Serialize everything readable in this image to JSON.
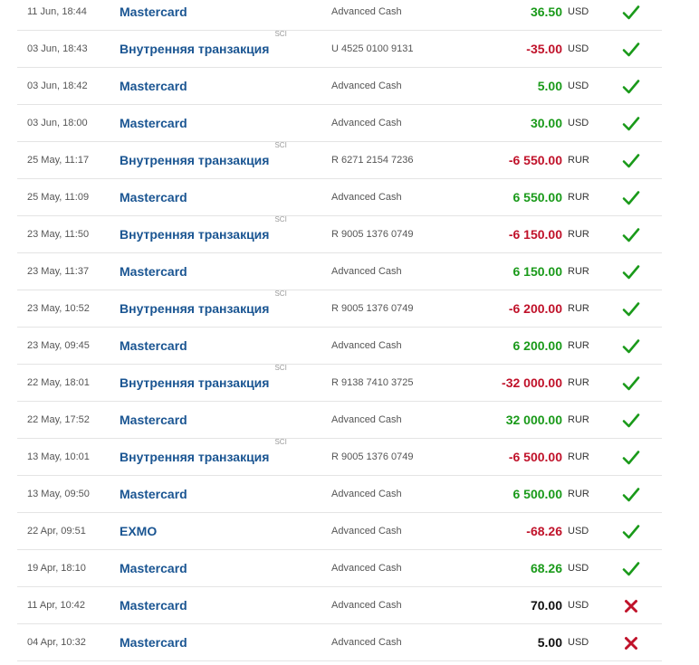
{
  "colors": {
    "link": "#1a5592",
    "positive": "#1a9a1a",
    "negative": "#c0122a",
    "check": "#1a9a1a",
    "cross": "#c0122a"
  },
  "transactions": [
    {
      "date": "11 Jun, 18:44",
      "name": "Mastercard",
      "sci": "",
      "account": "Advanced Cash",
      "amount": "36.50",
      "sign": "pos",
      "currency": "USD",
      "status": "check-icon"
    },
    {
      "date": "03 Jun, 18:43",
      "name": "Внутренняя транзакция",
      "sci": "SCI",
      "account": "U 4525 0100 9131",
      "amount": "-35.00",
      "sign": "neg",
      "currency": "USD",
      "status": "check-icon"
    },
    {
      "date": "03 Jun, 18:42",
      "name": "Mastercard",
      "sci": "",
      "account": "Advanced Cash",
      "amount": "5.00",
      "sign": "pos",
      "currency": "USD",
      "status": "check-icon"
    },
    {
      "date": "03 Jun, 18:00",
      "name": "Mastercard",
      "sci": "",
      "account": "Advanced Cash",
      "amount": "30.00",
      "sign": "pos",
      "currency": "USD",
      "status": "check-icon"
    },
    {
      "date": "25 May, 11:17",
      "name": "Внутренняя транзакция",
      "sci": "SCI",
      "account": "R 6271 2154 7236",
      "amount": "-6 550.00",
      "sign": "neg",
      "currency": "RUR",
      "status": "check-icon"
    },
    {
      "date": "25 May, 11:09",
      "name": "Mastercard",
      "sci": "",
      "account": "Advanced Cash",
      "amount": "6 550.00",
      "sign": "pos",
      "currency": "RUR",
      "status": "check-icon"
    },
    {
      "date": "23 May, 11:50",
      "name": "Внутренняя транзакция",
      "sci": "SCI",
      "account": "R 9005 1376 0749",
      "amount": "-6 150.00",
      "sign": "neg",
      "currency": "RUR",
      "status": "check-icon"
    },
    {
      "date": "23 May, 11:37",
      "name": "Mastercard",
      "sci": "",
      "account": "Advanced Cash",
      "amount": "6 150.00",
      "sign": "pos",
      "currency": "RUR",
      "status": "check-icon"
    },
    {
      "date": "23 May, 10:52",
      "name": "Внутренняя транзакция",
      "sci": "SCI",
      "account": "R 9005 1376 0749",
      "amount": "-6 200.00",
      "sign": "neg",
      "currency": "RUR",
      "status": "check-icon"
    },
    {
      "date": "23 May, 09:45",
      "name": "Mastercard",
      "sci": "",
      "account": "Advanced Cash",
      "amount": "6 200.00",
      "sign": "pos",
      "currency": "RUR",
      "status": "check-icon"
    },
    {
      "date": "22 May, 18:01",
      "name": "Внутренняя транзакция",
      "sci": "SCI",
      "account": "R 9138 7410 3725",
      "amount": "-32 000.00",
      "sign": "neg",
      "currency": "RUR",
      "status": "check-icon"
    },
    {
      "date": "22 May, 17:52",
      "name": "Mastercard",
      "sci": "",
      "account": "Advanced Cash",
      "amount": "32 000.00",
      "sign": "pos",
      "currency": "RUR",
      "status": "check-icon"
    },
    {
      "date": "13 May, 10:01",
      "name": "Внутренняя транзакция",
      "sci": "SCI",
      "account": "R 9005 1376 0749",
      "amount": "-6 500.00",
      "sign": "neg",
      "currency": "RUR",
      "status": "check-icon"
    },
    {
      "date": "13 May, 09:50",
      "name": "Mastercard",
      "sci": "",
      "account": "Advanced Cash",
      "amount": "6 500.00",
      "sign": "pos",
      "currency": "RUR",
      "status": "check-icon"
    },
    {
      "date": "22 Apr, 09:51",
      "name": "EXMO",
      "sci": "",
      "account": "Advanced Cash",
      "amount": "-68.26",
      "sign": "neg",
      "currency": "USD",
      "status": "check-icon"
    },
    {
      "date": "19 Apr, 18:10",
      "name": "Mastercard",
      "sci": "",
      "account": "Advanced Cash",
      "amount": "68.26",
      "sign": "pos",
      "currency": "USD",
      "status": "check-icon"
    },
    {
      "date": "11 Apr, 10:42",
      "name": "Mastercard",
      "sci": "",
      "account": "Advanced Cash",
      "amount": "70.00",
      "sign": "neutral",
      "currency": "USD",
      "status": "cross-icon"
    },
    {
      "date": "04 Apr, 10:32",
      "name": "Mastercard",
      "sci": "",
      "account": "Advanced Cash",
      "amount": "5.00",
      "sign": "neutral",
      "currency": "USD",
      "status": "cross-icon"
    }
  ]
}
